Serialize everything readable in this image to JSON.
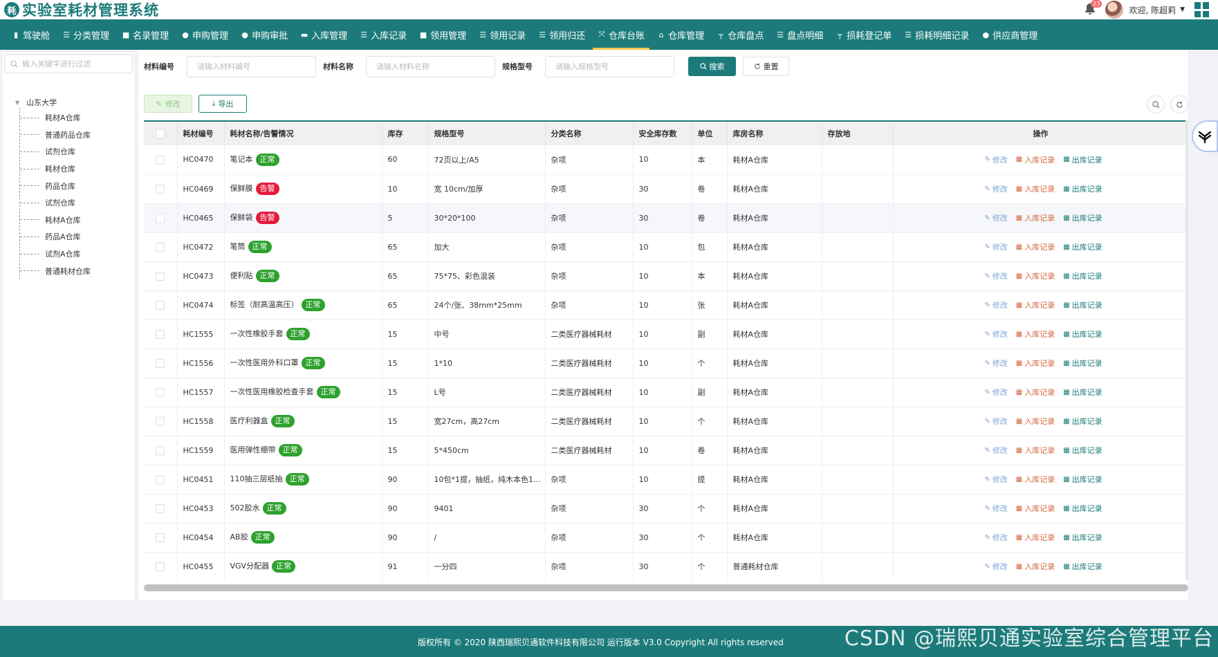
{
  "app": {
    "logo_char": "耗",
    "title": "实验室耗材管理系统"
  },
  "header": {
    "notification_count": "23",
    "welcome": "欢迎, 陈超莉"
  },
  "nav": [
    {
      "label": "驾驶舱",
      "icon": "bar-chart-icon"
    },
    {
      "label": "分类管理",
      "icon": "sliders-icon"
    },
    {
      "label": "名录管理",
      "icon": "book-icon"
    },
    {
      "label": "申购管理",
      "icon": "user-icon"
    },
    {
      "label": "申购审批",
      "icon": "user-check-icon"
    },
    {
      "label": "入库管理",
      "icon": "truck-icon"
    },
    {
      "label": "入库记录",
      "icon": "list-icon"
    },
    {
      "label": "领用管理",
      "icon": "book-icon"
    },
    {
      "label": "领用记录",
      "icon": "list-icon"
    },
    {
      "label": "领用归还",
      "icon": "sliders-icon"
    },
    {
      "label": "仓库台账",
      "icon": "expand-icon",
      "active": true
    },
    {
      "label": "仓库管理",
      "icon": "home-icon"
    },
    {
      "label": "仓库盘点",
      "icon": "hierarchy-icon"
    },
    {
      "label": "盘点明细",
      "icon": "list-icon"
    },
    {
      "label": "损耗登记单",
      "icon": "hierarchy-icon"
    },
    {
      "label": "损耗明细记录",
      "icon": "sliders-icon"
    },
    {
      "label": "供应商管理",
      "icon": "users-icon"
    }
  ],
  "sidebar": {
    "search_placeholder": "输入关键字进行过滤",
    "root": "山东大学",
    "children": [
      "耗材A仓库",
      "普通药品仓库",
      "试剂仓库",
      "耗材仓库",
      "药品仓库",
      "试剂仓库",
      "耗材A仓库",
      "药品A仓库",
      "试剂A仓库",
      "普通耗材仓库"
    ]
  },
  "filter": {
    "code_label": "材料编号",
    "code_placeholder": "请输入材料编号",
    "name_label": "材料名称",
    "name_placeholder": "请输入材料名称",
    "spec_label": "规格型号",
    "spec_placeholder": "请输入规格型号",
    "search_label": "搜索",
    "reset_label": "重置"
  },
  "toolbar": {
    "edit_label": "修改",
    "export_label": "导出"
  },
  "table": {
    "headers": [
      "耗材编号",
      "耗材名称/告警情况",
      "库存",
      "规格型号",
      "分类名称",
      "安全库存数",
      "单位",
      "库房名称",
      "存放地",
      "操作"
    ],
    "op_labels": {
      "edit": "修改",
      "in": "入库记录",
      "out": "出库记录"
    },
    "rows": [
      {
        "code": "HC0470",
        "name": "笔记本",
        "status": "正常",
        "stock": "60",
        "spec": "72页以上/A5",
        "category": "杂项",
        "safe": "10",
        "unit": "本",
        "warehouse": "耗材A仓库",
        "location": ""
      },
      {
        "code": "HC0469",
        "name": "保鲜膜",
        "status": "告警",
        "stock": "10",
        "spec": "宽 10cm/加厚",
        "category": "杂项",
        "safe": "30",
        "unit": "卷",
        "warehouse": "耗材A仓库",
        "location": ""
      },
      {
        "code": "HC0465",
        "name": "保鲜袋",
        "status": "告警",
        "stock": "5",
        "spec": "30*20*100",
        "category": "杂项",
        "safe": "30",
        "unit": "卷",
        "warehouse": "耗材A仓库",
        "location": ""
      },
      {
        "code": "HC0472",
        "name": "笔筒",
        "status": "正常",
        "stock": "65",
        "spec": "加大",
        "category": "杂项",
        "safe": "10",
        "unit": "包",
        "warehouse": "耗材A仓库",
        "location": ""
      },
      {
        "code": "HC0473",
        "name": "便利贴",
        "status": "正常",
        "stock": "65",
        "spec": "75*75、彩色混装",
        "category": "杂项",
        "safe": "10",
        "unit": "本",
        "warehouse": "耗材A仓库",
        "location": ""
      },
      {
        "code": "HC0474",
        "name": "标签（耐高温高压）",
        "status": "正常",
        "stock": "65",
        "spec": "24个/张、38mm*25mm",
        "category": "杂项",
        "safe": "10",
        "unit": "张",
        "warehouse": "耗材A仓库",
        "location": ""
      },
      {
        "code": "HC1555",
        "name": "一次性橡胶手套",
        "status": "正常",
        "stock": "15",
        "spec": "中号",
        "category": "二类医疗器械耗材",
        "safe": "10",
        "unit": "副",
        "warehouse": "耗材A仓库",
        "location": ""
      },
      {
        "code": "HC1556",
        "name": "一次性医用外科口罩",
        "status": "正常",
        "stock": "15",
        "spec": "1*10",
        "category": "二类医疗器械耗材",
        "safe": "10",
        "unit": "个",
        "warehouse": "耗材A仓库",
        "location": ""
      },
      {
        "code": "HC1557",
        "name": "一次性医用橡胶检查手套",
        "status": "正常",
        "stock": "15",
        "spec": "L号",
        "category": "二类医疗器械耗材",
        "safe": "10",
        "unit": "副",
        "warehouse": "耗材A仓库",
        "location": ""
      },
      {
        "code": "HC1558",
        "name": "医疗利器盒",
        "status": "正常",
        "stock": "15",
        "spec": "宽27cm，高27cm",
        "category": "二类医疗器械耗材",
        "safe": "10",
        "unit": "个",
        "warehouse": "耗材A仓库",
        "location": ""
      },
      {
        "code": "HC1559",
        "name": "医用弹性绷带",
        "status": "正常",
        "stock": "15",
        "spec": "5*450cm",
        "category": "二类医疗器械耗材",
        "safe": "10",
        "unit": "卷",
        "warehouse": "耗材A仓库",
        "location": ""
      },
      {
        "code": "HC0451",
        "name": "110抽三层纸抽",
        "status": "正常",
        "stock": "90",
        "spec": "10包*1提，抽纸，纯木本色110...",
        "category": "杂项",
        "safe": "10",
        "unit": "提",
        "warehouse": "耗材A仓库",
        "location": ""
      },
      {
        "code": "HC0453",
        "name": "502胶水",
        "status": "正常",
        "stock": "90",
        "spec": "9401",
        "category": "杂项",
        "safe": "30",
        "unit": "个",
        "warehouse": "耗材A仓库",
        "location": ""
      },
      {
        "code": "HC0454",
        "name": "AB胶",
        "status": "正常",
        "stock": "90",
        "spec": "/",
        "category": "杂项",
        "safe": "30",
        "unit": "个",
        "warehouse": "耗材A仓库",
        "location": ""
      },
      {
        "code": "HC0455",
        "name": "VGV分配器",
        "status": "正常",
        "stock": "91",
        "spec": "一分四",
        "category": "杂项",
        "safe": "30",
        "unit": "个",
        "warehouse": "普通耗材仓库",
        "location": ""
      }
    ]
  },
  "footer": {
    "text": "版权所有 © 2020 陕西瑞熙贝通软件科技有限公司 运行版本 V3.0 Copyright All rights reserved"
  },
  "watermark": "CSDN @瑞熙贝通实验室综合管理平台",
  "colors": {
    "primary": "#1c7b7a",
    "ok": "#2ea12e",
    "warn": "#e61b3b",
    "active_underline": "#f7c64c"
  }
}
